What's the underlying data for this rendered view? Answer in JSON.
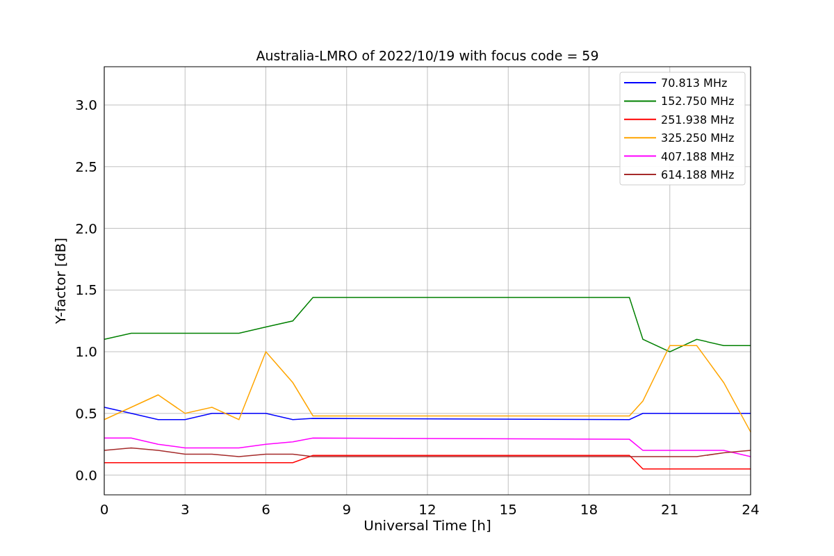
{
  "chart_data": {
    "type": "line",
    "title": "Australia-LMRO of 2022/10/19 with focus code = 59",
    "xlabel": "Universal Time [h]",
    "ylabel": "Y-factor [dB]",
    "x": [
      0,
      1,
      2,
      3,
      4,
      5,
      6,
      7,
      7.75,
      19.5,
      20,
      21,
      22,
      23,
      24
    ],
    "series": [
      {
        "name": "70.813 MHz",
        "color": "#0000ff",
        "values": [
          0.55,
          0.5,
          0.45,
          0.45,
          0.5,
          0.5,
          0.5,
          0.45,
          0.46,
          0.45,
          0.5,
          0.5,
          0.5,
          0.5,
          0.5
        ]
      },
      {
        "name": "152.750 MHz",
        "color": "#008000",
        "values": [
          1.1,
          1.15,
          1.15,
          1.15,
          1.15,
          1.15,
          1.2,
          1.25,
          1.44,
          1.44,
          1.1,
          1.0,
          1.1,
          1.05,
          1.05
        ]
      },
      {
        "name": "251.938 MHz",
        "color": "#ff0000",
        "values": [
          0.1,
          0.1,
          0.1,
          0.1,
          0.1,
          0.1,
          0.1,
          0.1,
          0.16,
          0.16,
          0.05,
          0.05,
          0.05,
          0.05,
          0.05
        ]
      },
      {
        "name": "325.250 MHz",
        "color": "#ffa500",
        "values": [
          0.45,
          0.55,
          0.65,
          0.5,
          0.55,
          0.45,
          1.0,
          0.75,
          0.48,
          0.48,
          0.6,
          1.05,
          1.05,
          0.75,
          0.35
        ]
      },
      {
        "name": "407.188 MHz",
        "color": "#ff00ff",
        "values": [
          0.3,
          0.3,
          0.25,
          0.22,
          0.22,
          0.22,
          0.25,
          0.27,
          0.3,
          0.29,
          0.2,
          0.2,
          0.2,
          0.2,
          0.15
        ]
      },
      {
        "name": "614.188 MHz",
        "color": "#a52a2a",
        "values": [
          0.2,
          0.22,
          0.2,
          0.17,
          0.17,
          0.15,
          0.17,
          0.17,
          0.15,
          0.15,
          0.15,
          0.15,
          0.15,
          0.18,
          0.2
        ]
      }
    ],
    "grid": true,
    "legend": true,
    "xlim": [
      0,
      24
    ],
    "ylim": [
      -0.16,
      3.31
    ],
    "xticks": [
      0,
      3,
      6,
      9,
      12,
      15,
      18,
      21,
      24
    ],
    "yticks": [
      {
        "value": 0,
        "label": "0.0"
      },
      {
        "value": 0.5,
        "label": "0.5"
      },
      {
        "value": 1,
        "label": "1.0"
      },
      {
        "value": 1.5,
        "label": "1.5"
      },
      {
        "value": 2,
        "label": "2.0"
      },
      {
        "value": 2.5,
        "label": "2.5"
      },
      {
        "value": 3,
        "label": "3.0"
      }
    ]
  }
}
